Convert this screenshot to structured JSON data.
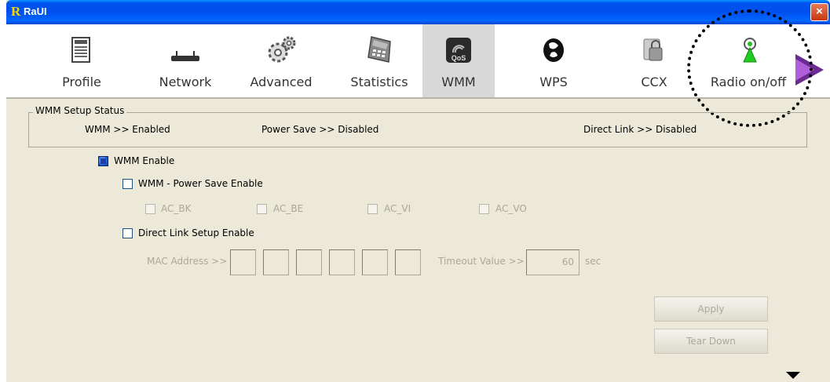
{
  "window": {
    "title": "RaUI",
    "logo": "R",
    "close": "×"
  },
  "toolbar": {
    "items": [
      {
        "label": "Profile",
        "icon": "profile-icon"
      },
      {
        "label": "Network",
        "icon": "network-icon"
      },
      {
        "label": "Advanced",
        "icon": "advanced-icon"
      },
      {
        "label": "Statistics",
        "icon": "statistics-icon"
      },
      {
        "label": "WMM",
        "icon": "wmm-icon",
        "active": true,
        "badge": "QoS"
      },
      {
        "label": "WPS",
        "icon": "wps-icon"
      },
      {
        "label": "CCX",
        "icon": "ccx-icon"
      },
      {
        "label": "Radio on/off",
        "icon": "radio-icon"
      }
    ]
  },
  "status_group": {
    "title": "WMM Setup Status",
    "wmm": "WMM >> Enabled",
    "power_save": "Power Save >> Disabled",
    "direct_link": "Direct Link >> Disabled"
  },
  "options": {
    "wmm_enable": {
      "label": "WMM Enable",
      "checked": true
    },
    "power_save_enable": {
      "label": "WMM - Power Save Enable",
      "checked": false
    },
    "ac": [
      "AC_BK",
      "AC_BE",
      "AC_VI",
      "AC_VO"
    ],
    "direct_link_enable": {
      "label": "Direct Link Setup Enable",
      "checked": false
    },
    "mac_label": "MAC Address >>",
    "timeout_label": "Timeout Value >>",
    "timeout_value": "60",
    "timeout_unit": "sec"
  },
  "buttons": {
    "apply": "Apply",
    "tear_down": "Tear Down"
  },
  "colors": {
    "title_bar": "#0055ea",
    "window_bg": "#ece9d8",
    "disabled_text": "#aca899"
  }
}
